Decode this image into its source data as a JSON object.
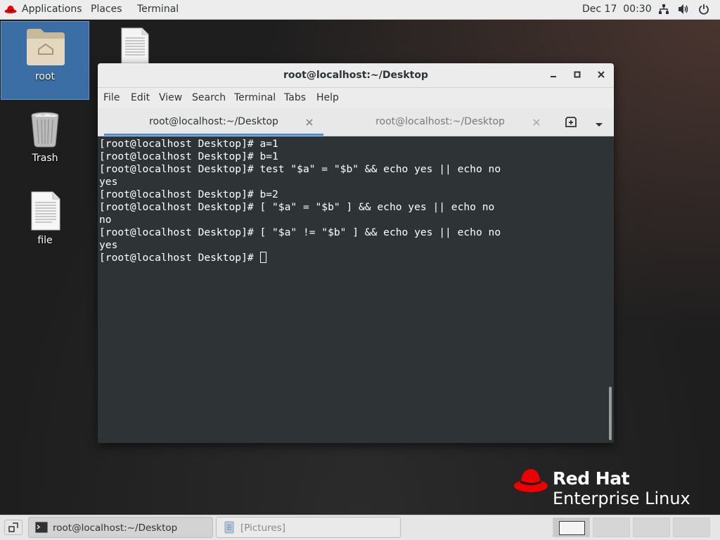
{
  "topbar": {
    "applications": "Applications",
    "places": "Places",
    "terminal": "Terminal",
    "datetime": "Dec 17  00:30",
    "icons": [
      "network-icon",
      "volume-icon",
      "power-icon"
    ]
  },
  "desktop": {
    "icons": [
      {
        "label": "root",
        "icon": "home-folder-icon"
      },
      {
        "label": "Trash",
        "icon": "trash-icon"
      },
      {
        "label": "file",
        "icon": "text-file-icon"
      }
    ]
  },
  "window": {
    "title": "root@localhost:~/Desktop",
    "menu": [
      "File",
      "Edit",
      "View",
      "Search",
      "Terminal",
      "Tabs",
      "Help"
    ],
    "tabs": [
      {
        "label": "root@localhost:~/Desktop",
        "active": true
      },
      {
        "label": "root@localhost:~/Desktop",
        "active": false
      }
    ],
    "terminal_lines": [
      "[root@localhost Desktop]# a=1",
      "[root@localhost Desktop]# b=1",
      "[root@localhost Desktop]# test \"$a\" = \"$b\" && echo yes || echo no",
      "yes",
      "[root@localhost Desktop]# b=2",
      "[root@localhost Desktop]# [ \"$a\" = \"$b\" ] && echo yes || echo no",
      "no",
      "[root@localhost Desktop]# [ \"$a\" != \"$b\" ] && echo yes || echo no",
      "yes",
      "[root@localhost Desktop]# "
    ]
  },
  "brand": {
    "line1": "Red Hat",
    "line2": "Enterprise Linux",
    "color": "#ee0000"
  },
  "taskbar": {
    "items": [
      {
        "label": "root@localhost:~/Desktop",
        "icon": "terminal-icon",
        "active": true
      },
      {
        "label": "[Pictures]",
        "icon": "file-manager-icon",
        "active": false
      }
    ],
    "workspaces": 4,
    "active_workspace": 1
  }
}
